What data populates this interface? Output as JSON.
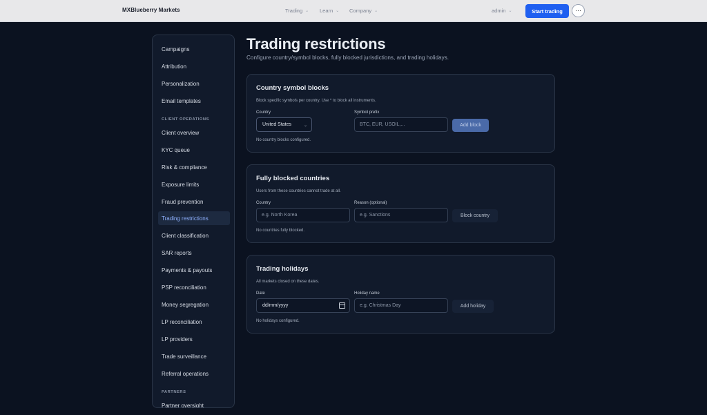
{
  "topbar": {
    "brand": "MXBlueberry Markets",
    "nav": [
      {
        "label": "Trading"
      },
      {
        "label": "Learn"
      },
      {
        "label": "Company"
      }
    ],
    "admin_label": "admin",
    "start_label": "Start trading",
    "more_glyph": "⋯"
  },
  "sidebar": {
    "items_top": [
      {
        "label": "Campaigns"
      },
      {
        "label": "Attribution"
      },
      {
        "label": "Personalization"
      },
      {
        "label": "Email templates"
      }
    ],
    "section_client": "CLIENT OPERATIONS",
    "items_client": [
      {
        "label": "Client overview"
      },
      {
        "label": "KYC queue"
      },
      {
        "label": "Risk & compliance"
      },
      {
        "label": "Exposure limits"
      },
      {
        "label": "Fraud prevention"
      },
      {
        "label": "Trading restrictions",
        "active": true
      },
      {
        "label": "Client classification"
      },
      {
        "label": "SAR reports"
      },
      {
        "label": "Payments & payouts"
      },
      {
        "label": "PSP reconciliation"
      },
      {
        "label": "Money segregation"
      },
      {
        "label": "LP reconciliation"
      },
      {
        "label": "LP providers"
      },
      {
        "label": "Trade surveillance"
      },
      {
        "label": "Referral operations"
      }
    ],
    "section_partners": "PARTNERS",
    "items_partners": [
      {
        "label": "Partner oversight"
      }
    ]
  },
  "page": {
    "title": "Trading restrictions",
    "subtitle": "Configure country/symbol blocks, fully blocked jurisdictions, and trading holidays."
  },
  "symbol_blocks": {
    "title": "Country symbol blocks",
    "description": "Block specific symbols per country. Use * to block all instruments.",
    "country_label": "Country",
    "country_value": "United States",
    "prefix_label": "Symbol prefix",
    "prefix_placeholder": "BTC, EUR, USOIL,...",
    "button_label": "Add block",
    "empty_text": "No country blocks configured."
  },
  "blocked_countries": {
    "title": "Fully blocked countries",
    "description": "Users from these countries cannot trade at all.",
    "country_label": "Country",
    "country_placeholder": "e.g. North Korea",
    "reason_label": "Reason (optional)",
    "reason_placeholder": "e.g. Sanctions",
    "button_label": "Block country",
    "empty_text": "No countries fully blocked."
  },
  "holidays": {
    "title": "Trading holidays",
    "description": "All markets closed on these dates.",
    "date_label": "Date",
    "date_placeholder": "dd/mm/yyyy",
    "name_label": "Holiday name",
    "name_placeholder": "e.g. Christmas Day",
    "button_label": "Add holiday",
    "empty_text": "No holidays configured."
  }
}
